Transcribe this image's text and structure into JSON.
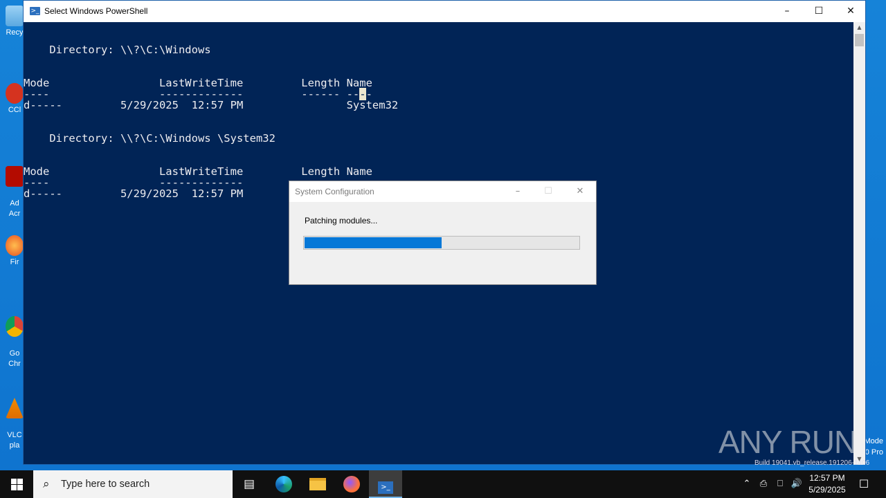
{
  "desktop": {
    "icons": [
      {
        "name": "recycle-bin",
        "label": "Recy"
      },
      {
        "name": "ccleaner",
        "label": "CCl"
      },
      {
        "name": "adobe-acrobat",
        "label": "Ad\nAcr"
      },
      {
        "name": "firefox",
        "label": "Fir"
      },
      {
        "name": "google-chrome",
        "label": "Go\nChr"
      },
      {
        "name": "vlc",
        "label": "VLC\npla"
      }
    ],
    "edition_line1": "Mode",
    "edition_line2": "0 Pro",
    "build_text": "Build 19041.vb_release.191206-1406"
  },
  "powershell": {
    "title": "Select Windows PowerShell",
    "lines": {
      "dir1": "    Directory: \\\\?\\C:\\Windows",
      "hdr1": "Mode                 LastWriteTime         Length Name",
      "sep1a": "----                 -------------         ------ --",
      "sep1cursor": "-",
      "sep1b": "-",
      "row1": "d-----         5/29/2025  12:57 PM                System32",
      "dir2": "    Directory: \\\\?\\C:\\Windows \\System32",
      "hdr2": "Mode                 LastWriteTime         Length Name",
      "sep2": "----                 -------------",
      "row2": "d-----         5/29/2025  12:57 PM"
    }
  },
  "dialog": {
    "title": "System Configuration",
    "message": "Patching modules...",
    "progress_fraction": 0.5
  },
  "watermark": "ANY RUN",
  "taskbar": {
    "search_placeholder": "Type here to search",
    "clock_time": "12:57 PM",
    "clock_date": "5/29/2025"
  },
  "colors": {
    "console_bg": "#012456",
    "progress_fill": "#0678d7",
    "desktop_bg": "#1683d8"
  }
}
